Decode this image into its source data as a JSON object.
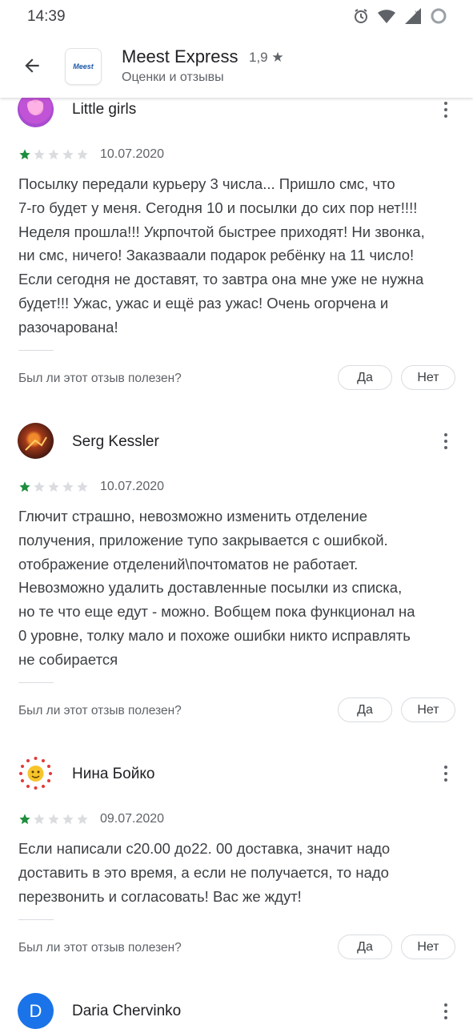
{
  "status": {
    "time": "14:39"
  },
  "app": {
    "title": "Meest Express",
    "rating": "1,9 ★",
    "subtitle": "Оценки и отзывы",
    "logo_text": "Meest"
  },
  "reviews": [
    {
      "name": "Little girls",
      "stars": 1,
      "date": "10.07.2020",
      "text": "Посылку передали курьеру 3 числа... Пришло смс, что\n7-го будет у меня. Сегодня 10 и посылки до сих пор нет!!!!\nНеделя прошла!!! Укрпочтой быстрее приходят! Ни звонка,\nни смс, ничего! Заказваали подарок ребёнку на 11 число!\nЕсли сегодня не доставят, то завтра она мне уже не нужна\nбудет!!! Ужас, ужас и ещё раз ужас! Очень огорчена и\nразочарована!",
      "helpful_q": "Был ли этот отзыв полезен?",
      "yes": "Да",
      "no": "Нет"
    },
    {
      "name": "Serg Kessler",
      "stars": 1,
      "date": "10.07.2020",
      "text": "Глючит страшно, невозможно изменить отделение\nполучения, приложение тупо закрывается с ошибкой.\nотображение отделений\\почтоматов не работает.\nНевозможно удалить доставленные посылки из списка,\nно те что еще едут - можно. Вобщем пока функционал на\n0 уровне, толку мало и похоже ошибки никто исправлять\nне собирается",
      "helpful_q": "Был ли этот отзыв полезен?",
      "yes": "Да",
      "no": "Нет"
    },
    {
      "name": "Нина Бойко",
      "stars": 1,
      "date": "09.07.2020",
      "text": "Если написали с20.00 до22. 00 доставка, значит надо\nдоставить в это время, а если не получается, то надо\nперезвонить и согласовать! Вас же ждут!",
      "helpful_q": "Был ли этот отзыв полезен?",
      "yes": "Да",
      "no": "Нет"
    },
    {
      "name": "Daria Chervinko",
      "avatar_letter": "D"
    }
  ],
  "colors": {
    "star_filled": "#1e8e3e",
    "star_empty": "#dadce0",
    "avatar_d": "#1a73e8"
  }
}
